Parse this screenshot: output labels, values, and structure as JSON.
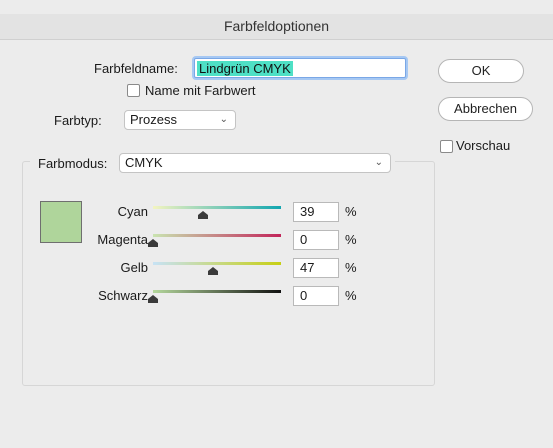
{
  "dialog": {
    "title": "Farbfeldoptionen"
  },
  "form": {
    "name_label": "Farbfeldname:",
    "name_value": "Lindgrün CMYK",
    "name_with_value_label": "Name mit Farbwert",
    "name_with_value_checked": false,
    "type_label": "Farbtyp:",
    "type_value": "Prozess",
    "mode_label": "Farbmodus:",
    "mode_value": "CMYK"
  },
  "buttons": {
    "ok": "OK",
    "cancel": "Abbrechen"
  },
  "preview": {
    "label": "Vorschau",
    "checked": false
  },
  "swatch_color": "#afd59b",
  "sliders": [
    {
      "label": "Cyan",
      "value": "39",
      "unit": "%",
      "gradient_from": "#f3f4c0",
      "gradient_to": "#12a6b0"
    },
    {
      "label": "Magenta",
      "value": "0",
      "unit": "%",
      "gradient_from": "#c9e4b0",
      "gradient_to": "#c2255a"
    },
    {
      "label": "Gelb",
      "value": "47",
      "unit": "%",
      "gradient_from": "#c7e2f5",
      "gradient_to": "#c7cf14"
    },
    {
      "label": "Schwarz",
      "value": "0",
      "unit": "%",
      "gradient_from": "#b4d79c",
      "gradient_to": "#111111"
    }
  ]
}
